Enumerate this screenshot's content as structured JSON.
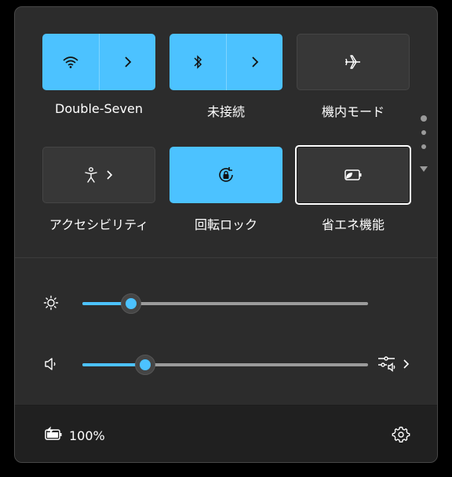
{
  "quick_settings": {
    "tiles": [
      {
        "label": "Double-Seven",
        "icon": "wifi-icon",
        "state": "on",
        "has_chevron": true
      },
      {
        "label": "未接続",
        "icon": "bluetooth-icon",
        "state": "on",
        "has_chevron": true
      },
      {
        "label": "機内モード",
        "icon": "airplane-icon",
        "state": "off",
        "has_chevron": false
      },
      {
        "label": "アクセシビリティ",
        "icon": "accessibility-icon",
        "state": "off",
        "has_chevron": true
      },
      {
        "label": "回転ロック",
        "icon": "rotation-lock-icon",
        "state": "on",
        "has_chevron": false
      },
      {
        "label": "省エネ機能",
        "icon": "battery-saver-icon",
        "state": "off",
        "has_chevron": false
      }
    ],
    "page_indicator": {
      "pages": 3,
      "current": 1
    }
  },
  "sliders": {
    "brightness": {
      "icon": "brightness-icon",
      "value": 0.17
    },
    "volume": {
      "icon": "speaker-icon",
      "value": 0.22,
      "output_icon": "audio-mixer-icon"
    }
  },
  "footer": {
    "battery_icon": "battery-charging-icon",
    "battery_text": "100%",
    "settings_icon": "gear-icon"
  },
  "colors": {
    "accent": "#4cc2ff",
    "panel": "#2c2c2c",
    "footer": "#202020",
    "tile_off": "#373737"
  }
}
